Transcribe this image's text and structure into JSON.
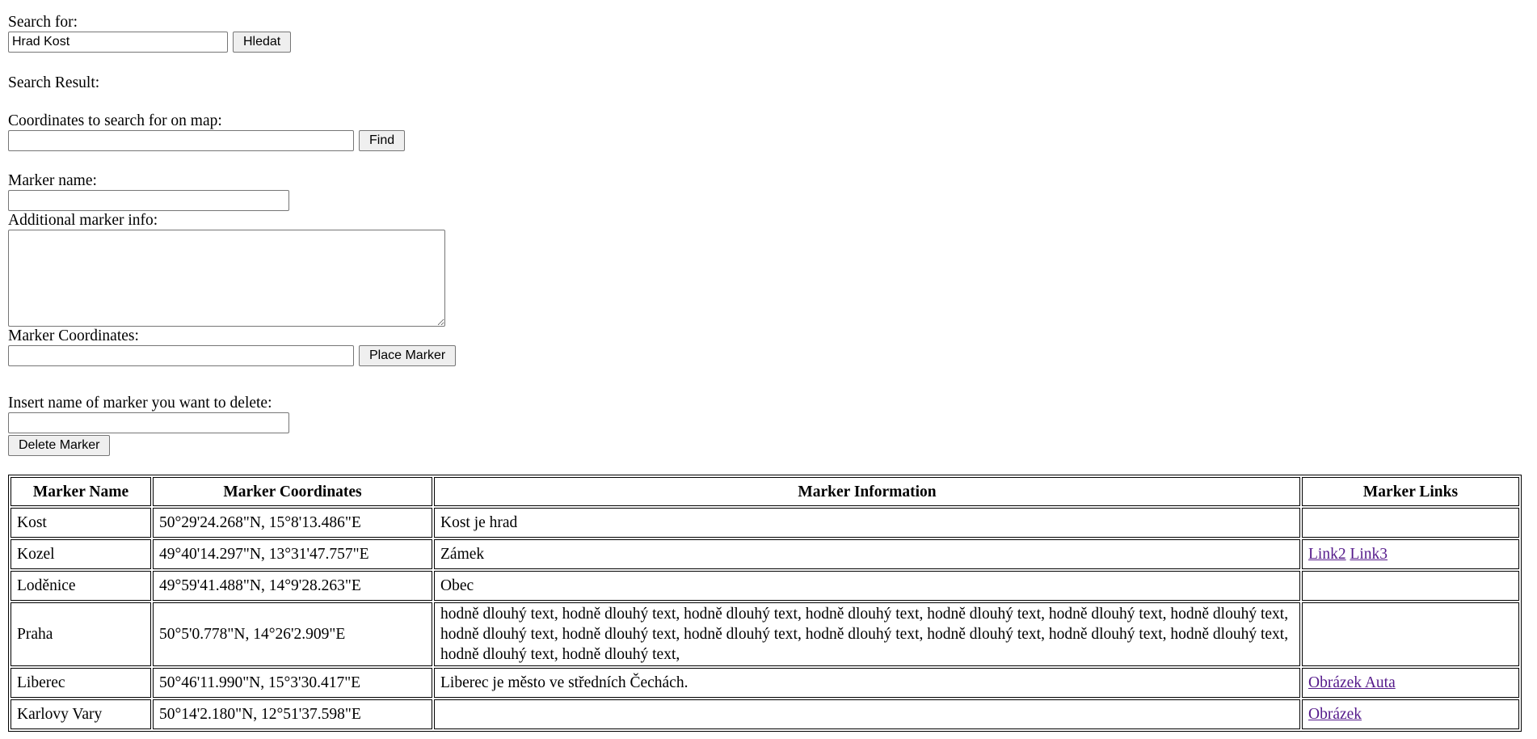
{
  "search": {
    "label": "Search for:",
    "value": "Hrad Kost",
    "button": "Hledat",
    "result_label": "Search Result:"
  },
  "coords_search": {
    "label": "Coordinates to search for on map:",
    "value": "",
    "button": "Find"
  },
  "marker_form": {
    "name_label": "Marker name:",
    "name_value": "",
    "info_label": "Additional marker info:",
    "info_value": "",
    "coords_label": "Marker Coordinates:",
    "coords_value": "",
    "place_button": "Place Marker"
  },
  "delete_form": {
    "label": "Insert name of marker you want to delete:",
    "value": "",
    "button": "Delete Marker"
  },
  "table": {
    "headers": [
      "Marker Name",
      "Marker Coordinates",
      "Marker Information",
      "Marker Links"
    ],
    "rows": [
      {
        "name": "Kost",
        "coords": "50°29'24.268\"N, 15°8'13.486\"E",
        "info": "Kost je hrad",
        "links": []
      },
      {
        "name": "Kozel",
        "coords": "49°40'14.297\"N, 13°31'47.757\"E",
        "info": "Zámek",
        "links": [
          "Link2",
          "Link3"
        ]
      },
      {
        "name": "Loděnice",
        "coords": "49°59'41.488\"N, 14°9'28.263\"E",
        "info": "Obec",
        "links": []
      },
      {
        "name": "Praha",
        "coords": "50°5'0.778\"N, 14°26'2.909\"E",
        "info": "hodně dlouhý text, hodně dlouhý text, hodně dlouhý text, hodně dlouhý text, hodně dlouhý text, hodně dlouhý text, hodně dlouhý text, hodně dlouhý text, hodně dlouhý text, hodně dlouhý text, hodně dlouhý text, hodně dlouhý text, hodně dlouhý text, hodně dlouhý text, hodně dlouhý text, hodně dlouhý text,",
        "links": []
      },
      {
        "name": "Liberec",
        "coords": "50°46'11.990\"N, 15°3'30.417\"E",
        "info": "Liberec je město ve středních Čechách.",
        "links": [
          "Obrázek Auta"
        ]
      },
      {
        "name": "Karlovy Vary",
        "coords": "50°14'2.180\"N, 12°51'37.598\"E",
        "info": "",
        "links": [
          "Obrázek"
        ]
      }
    ]
  }
}
